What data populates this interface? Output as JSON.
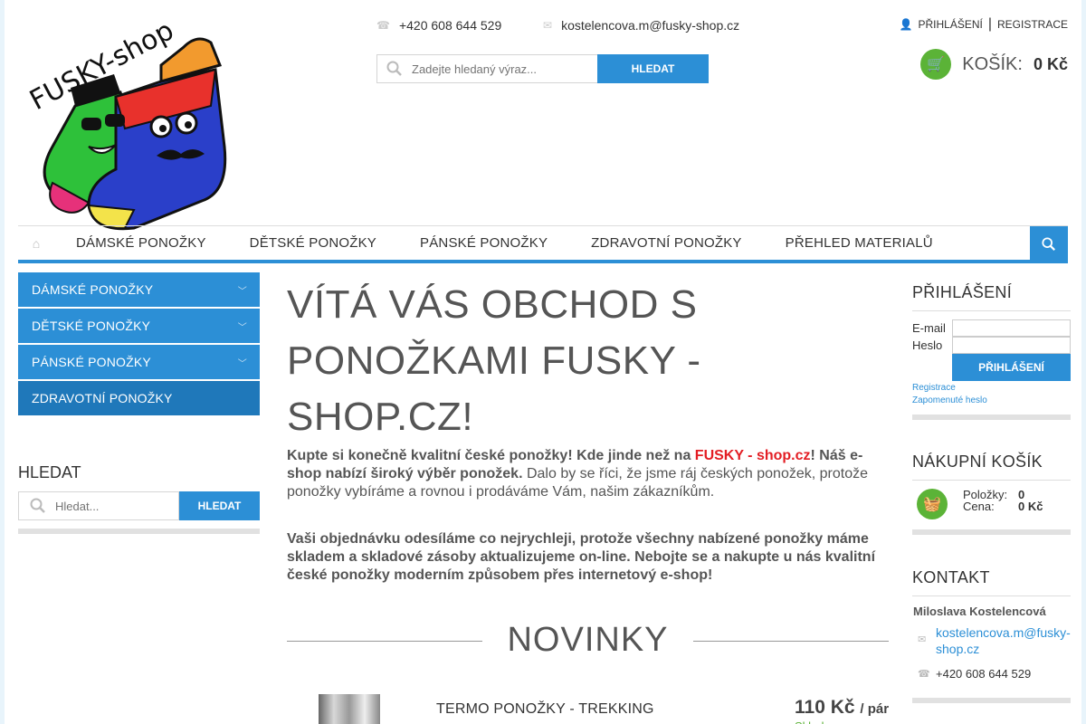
{
  "header": {
    "logo_text": "FUSKY-shop",
    "phone": "+420 608 644 529",
    "email": "kostelencova.m@fusky-shop.cz",
    "search_placeholder": "Zadejte hledaný výraz...",
    "search_button": "HLEDAT",
    "login_link": "PŘIHLÁŠENÍ",
    "register_link": "REGISTRACE",
    "cart_label": "KOŠÍK:",
    "cart_amount": "0 Kč"
  },
  "nav": {
    "items": [
      "DÁMSKÉ PONOŽKY",
      "DĚTSKÉ PONOŽKY",
      "PÁNSKÉ PONOŽKY",
      "ZDRAVOTNÍ PONOŽKY",
      "PŘEHLED MATERIALŮ"
    ]
  },
  "left_sidebar": {
    "categories": [
      "DÁMSKÉ PONOŽKY",
      "DĚTSKÉ PONOŽKY",
      "PÁNSKÉ PONOŽKY",
      "ZDRAVOTNÍ PONOŽKY"
    ],
    "search_heading": "HLEDAT",
    "search_placeholder": "Hledat...",
    "search_button": "HLEDAT"
  },
  "main": {
    "title": "VÍTÁ VÁS OBCHOD S PONOŽKAMI FUSKY - SHOP.CZ!",
    "p1_bold_a": "Kupte si konečně kvalitní české ponožky! Kde jinde než na ",
    "p1_brand": "FUSKY - shop.cz",
    "p1_bold_b": "! Náš e-shop nabízí široký výběr ponožek.",
    "p1_rest": " Dalo by se říci, že jsme ráj českých ponožek, protože ponožky vybíráme a rovnou i prodáváme Vám, našim zákazníkům.",
    "p2": "Vaši objednávku odesíláme co nejrychleji, protože všechny nabízené ponožky máme skladem a skladové zásoby aktualizujeme on-line. Nebojte se a nakupte u nás kvalitní české ponožky moderním způsobem přes internetový e-shop!",
    "novinky_heading": "NOVINKY",
    "product": {
      "name": "TERMO PONOŽKY - TREKKING",
      "price": "110 Kč",
      "unit": "/ pár",
      "stock": "Skladem"
    }
  },
  "right_sidebar": {
    "login_heading": "PŘIHLÁŠENÍ",
    "email_label": "E-mail",
    "password_label": "Heslo",
    "login_button": "PŘIHLÁŠENÍ",
    "register_link": "Registrace",
    "forgot_link": "Zapomenuté heslo",
    "cart_heading": "NÁKUPNÍ KOŠÍK",
    "items_label": "Položky:",
    "items_value": "0",
    "price_label": "Cena:",
    "price_value": "0 Kč",
    "contact_heading": "KONTAKT",
    "contact_name": "Miloslava Kostelencová",
    "contact_email": "kostelencova.m@fusky-shop.cz",
    "contact_phone": "+420 608 644 529"
  },
  "colors": {
    "accent": "#2c8fd6",
    "brand_red": "#e31e24",
    "cart_green": "#5bb337"
  }
}
